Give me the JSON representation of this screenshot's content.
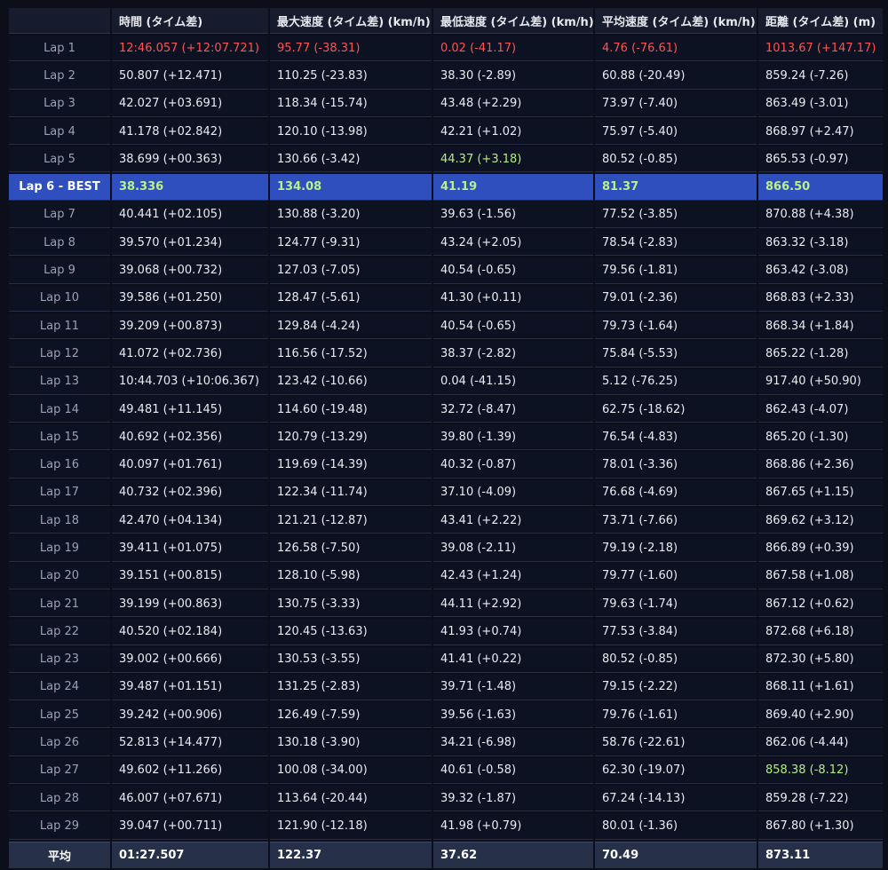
{
  "headers": [
    "",
    "時間 (タイム差)",
    "最大速度 (タイム差) (km/h)",
    "最低速度 (タイム差) (km/h)",
    "平均速度 (タイム差) (km/h)",
    "距離 (タイム差) (m)"
  ],
  "colors": {
    "accent_red": "#ff5252",
    "accent_green": "#b4ec7d",
    "best_row": "#2f4fbf",
    "best_value": "#b9f08a"
  },
  "rows": [
    {
      "lap": "Lap 1",
      "time": "12:46.057 (+12:07.721)",
      "max": "95.77 (-38.31)",
      "min": "0.02 (-41.17)",
      "avg": "4.76 (-76.61)",
      "dist": "1013.67 (+147.17)",
      "hl": {
        "time": "red",
        "max": "red",
        "min": "red",
        "avg": "red",
        "dist": "red"
      }
    },
    {
      "lap": "Lap 2",
      "time": "50.807 (+12.471)",
      "max": "110.25 (-23.83)",
      "min": "38.30 (-2.89)",
      "avg": "60.88 (-20.49)",
      "dist": "859.24 (-7.26)"
    },
    {
      "lap": "Lap 3",
      "time": "42.027 (+03.691)",
      "max": "118.34 (-15.74)",
      "min": "43.48 (+2.29)",
      "avg": "73.97 (-7.40)",
      "dist": "863.49 (-3.01)"
    },
    {
      "lap": "Lap 4",
      "time": "41.178 (+02.842)",
      "max": "120.10 (-13.98)",
      "min": "42.21 (+1.02)",
      "avg": "75.97 (-5.40)",
      "dist": "868.97 (+2.47)"
    },
    {
      "lap": "Lap 5",
      "time": "38.699 (+00.363)",
      "max": "130.66 (-3.42)",
      "min": "44.37 (+3.18)",
      "avg": "80.52 (-0.85)",
      "dist": "865.53 (-0.97)",
      "hl": {
        "min": "green"
      }
    },
    {
      "lap": "Lap 6 - BEST",
      "time": "38.336",
      "max": "134.08",
      "min": "41.19",
      "avg": "81.37",
      "dist": "866.50",
      "best": true
    },
    {
      "lap": "Lap 7",
      "time": "40.441 (+02.105)",
      "max": "130.88 (-3.20)",
      "min": "39.63 (-1.56)",
      "avg": "77.52 (-3.85)",
      "dist": "870.88 (+4.38)"
    },
    {
      "lap": "Lap 8",
      "time": "39.570 (+01.234)",
      "max": "124.77 (-9.31)",
      "min": "43.24 (+2.05)",
      "avg": "78.54 (-2.83)",
      "dist": "863.32 (-3.18)"
    },
    {
      "lap": "Lap 9",
      "time": "39.068 (+00.732)",
      "max": "127.03 (-7.05)",
      "min": "40.54 (-0.65)",
      "avg": "79.56 (-1.81)",
      "dist": "863.42 (-3.08)"
    },
    {
      "lap": "Lap 10",
      "time": "39.586 (+01.250)",
      "max": "128.47 (-5.61)",
      "min": "41.30 (+0.11)",
      "avg": "79.01 (-2.36)",
      "dist": "868.83 (+2.33)"
    },
    {
      "lap": "Lap 11",
      "time": "39.209 (+00.873)",
      "max": "129.84 (-4.24)",
      "min": "40.54 (-0.65)",
      "avg": "79.73 (-1.64)",
      "dist": "868.34 (+1.84)"
    },
    {
      "lap": "Lap 12",
      "time": "41.072 (+02.736)",
      "max": "116.56 (-17.52)",
      "min": "38.37 (-2.82)",
      "avg": "75.84 (-5.53)",
      "dist": "865.22 (-1.28)"
    },
    {
      "lap": "Lap 13",
      "time": "10:44.703 (+10:06.367)",
      "max": "123.42 (-10.66)",
      "min": "0.04 (-41.15)",
      "avg": "5.12 (-76.25)",
      "dist": "917.40 (+50.90)"
    },
    {
      "lap": "Lap 14",
      "time": "49.481 (+11.145)",
      "max": "114.60 (-19.48)",
      "min": "32.72 (-8.47)",
      "avg": "62.75 (-18.62)",
      "dist": "862.43 (-4.07)"
    },
    {
      "lap": "Lap 15",
      "time": "40.692 (+02.356)",
      "max": "120.79 (-13.29)",
      "min": "39.80 (-1.39)",
      "avg": "76.54 (-4.83)",
      "dist": "865.20 (-1.30)"
    },
    {
      "lap": "Lap 16",
      "time": "40.097 (+01.761)",
      "max": "119.69 (-14.39)",
      "min": "40.32 (-0.87)",
      "avg": "78.01 (-3.36)",
      "dist": "868.86 (+2.36)"
    },
    {
      "lap": "Lap 17",
      "time": "40.732 (+02.396)",
      "max": "122.34 (-11.74)",
      "min": "37.10 (-4.09)",
      "avg": "76.68 (-4.69)",
      "dist": "867.65 (+1.15)"
    },
    {
      "lap": "Lap 18",
      "time": "42.470 (+04.134)",
      "max": "121.21 (-12.87)",
      "min": "43.41 (+2.22)",
      "avg": "73.71 (-7.66)",
      "dist": "869.62 (+3.12)"
    },
    {
      "lap": "Lap 19",
      "time": "39.411 (+01.075)",
      "max": "126.58 (-7.50)",
      "min": "39.08 (-2.11)",
      "avg": "79.19 (-2.18)",
      "dist": "866.89 (+0.39)"
    },
    {
      "lap": "Lap 20",
      "time": "39.151 (+00.815)",
      "max": "128.10 (-5.98)",
      "min": "42.43 (+1.24)",
      "avg": "79.77 (-1.60)",
      "dist": "867.58 (+1.08)"
    },
    {
      "lap": "Lap 21",
      "time": "39.199 (+00.863)",
      "max": "130.75 (-3.33)",
      "min": "44.11 (+2.92)",
      "avg": "79.63 (-1.74)",
      "dist": "867.12 (+0.62)"
    },
    {
      "lap": "Lap 22",
      "time": "40.520 (+02.184)",
      "max": "120.45 (-13.63)",
      "min": "41.93 (+0.74)",
      "avg": "77.53 (-3.84)",
      "dist": "872.68 (+6.18)"
    },
    {
      "lap": "Lap 23",
      "time": "39.002 (+00.666)",
      "max": "130.53 (-3.55)",
      "min": "41.41 (+0.22)",
      "avg": "80.52 (-0.85)",
      "dist": "872.30 (+5.80)"
    },
    {
      "lap": "Lap 24",
      "time": "39.487 (+01.151)",
      "max": "131.25 (-2.83)",
      "min": "39.71 (-1.48)",
      "avg": "79.15 (-2.22)",
      "dist": "868.11 (+1.61)"
    },
    {
      "lap": "Lap 25",
      "time": "39.242 (+00.906)",
      "max": "126.49 (-7.59)",
      "min": "39.56 (-1.63)",
      "avg": "79.76 (-1.61)",
      "dist": "869.40 (+2.90)"
    },
    {
      "lap": "Lap 26",
      "time": "52.813 (+14.477)",
      "max": "130.18 (-3.90)",
      "min": "34.21 (-6.98)",
      "avg": "58.76 (-22.61)",
      "dist": "862.06 (-4.44)"
    },
    {
      "lap": "Lap 27",
      "time": "49.602 (+11.266)",
      "max": "100.08 (-34.00)",
      "min": "40.61 (-0.58)",
      "avg": "62.30 (-19.07)",
      "dist": "858.38 (-8.12)",
      "hl": {
        "dist": "green"
      }
    },
    {
      "lap": "Lap 28",
      "time": "46.007 (+07.671)",
      "max": "113.64 (-20.44)",
      "min": "39.32 (-1.87)",
      "avg": "67.24 (-14.13)",
      "dist": "859.28 (-7.22)"
    },
    {
      "lap": "Lap 29",
      "time": "39.047 (+00.711)",
      "max": "121.90 (-12.18)",
      "min": "41.98 (+0.79)",
      "avg": "80.01 (-1.36)",
      "dist": "867.80 (+1.30)"
    }
  ],
  "average": {
    "label": "平均",
    "time": "01:27.507",
    "max": "122.37",
    "min": "37.62",
    "avg": "70.49",
    "dist": "873.11"
  }
}
